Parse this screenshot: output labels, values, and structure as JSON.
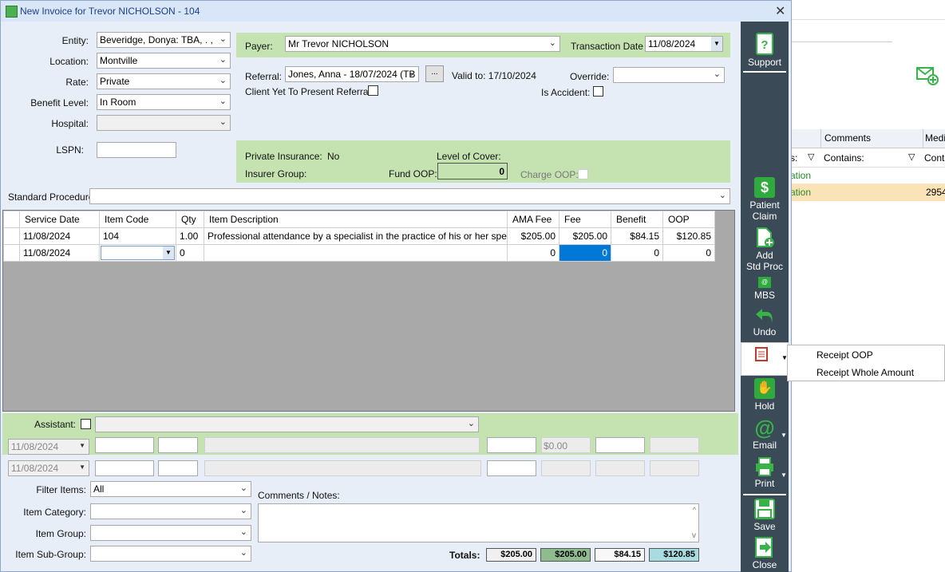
{
  "window": {
    "title": "New Invoice for Trevor NICHOLSON - 104",
    "close": "✕"
  },
  "left_form": {
    "entity_label": "Entity:",
    "entity_value": "Beveridge, Donya: TBA, . ,",
    "location_label": "Location:",
    "location_value": "Montville",
    "rate_label": "Rate:",
    "rate_value": "Private",
    "benefit_label": "Benefit Level:",
    "benefit_value": "In Room",
    "hospital_label": "Hospital:",
    "hospital_value": "",
    "lspn_label": "LSPN:",
    "lspn_value": ""
  },
  "payer": {
    "label": "Payer:",
    "value": "Mr Trevor NICHOLSON",
    "date_label": "Transaction Date",
    "date_value": "11/08/2024"
  },
  "referral": {
    "label": "Referral:",
    "value": "Jones, Anna - 18/07/2024 (TB",
    "ellipsis": "...",
    "valid_to": "Valid to: 17/10/2024",
    "override_label": "Override:",
    "override_value": "",
    "yet_to_present": "Client Yet To Present Referral:",
    "accident": "Is Accident:"
  },
  "insurance": {
    "private_label": "Private Insurance:",
    "private_value": "No",
    "cover_label": "Level of Cover:",
    "cover_value": "",
    "group_label": "Insurer Group:",
    "fund_oop_label": "Fund OOP:",
    "fund_oop_value": "0",
    "charge_oop_label": "Charge OOP:"
  },
  "std_proc": {
    "label": "Standard Procedure:",
    "value": ""
  },
  "grid": {
    "headers": [
      "Service Date",
      "Item Code",
      "Qty",
      "Item Description",
      "AMA Fee",
      "Fee",
      "Benefit",
      "OOP"
    ],
    "rows": [
      [
        "11/08/2024",
        "104",
        "1.00",
        "Professional attendance by a specialist in the practice of his or her spe...",
        "$205.00",
        "$205.00",
        "$84.15",
        "$120.85"
      ],
      [
        "11/08/2024",
        "",
        "0",
        "",
        "0",
        "0",
        "0",
        "0"
      ]
    ]
  },
  "assistant": {
    "label": "Assistant:",
    "date1": "11/08/2024",
    "date2": "11/08/2024",
    "fee_value": "$0.00"
  },
  "filters": {
    "filter_label": "Filter Items:",
    "filter_value": "All",
    "category_label": "Item Category:",
    "group_label": "Item Group:",
    "subgroup_label": "Item Sub-Group:",
    "comments_label": "Comments / Notes:"
  },
  "totals": {
    "label": "Totals:",
    "ama": "$205.00",
    "fee": "$205.00",
    "benefit": "$84.15",
    "oop": "$120.85"
  },
  "sidebar": {
    "support": "Support",
    "patient_claim": [
      "Patient",
      "Claim"
    ],
    "add_std_proc": [
      "Add",
      "Std Proc"
    ],
    "mbs": "MBS",
    "undo": "Undo",
    "hold": "Hold",
    "email": "Email",
    "print": "Print",
    "save": "Save",
    "close": "Close"
  },
  "receipt_menu": {
    "items": [
      "Receipt OOP",
      "Receipt Whole Amount"
    ]
  },
  "background": {
    "col_comments": "Comments",
    "col_medi": "Medi",
    "filter1": "s:",
    "filter2": "Contains:",
    "filter3": "Conta",
    "row1": "ation",
    "row2": "ation",
    "row2_val": "2954"
  },
  "colors": {
    "panel_green": "#c5e3b0",
    "sidebar": "#3b4a57",
    "highlight": "#0078d7",
    "fee_total": "#8fbc8f",
    "oop_total": "#a8dce0"
  }
}
